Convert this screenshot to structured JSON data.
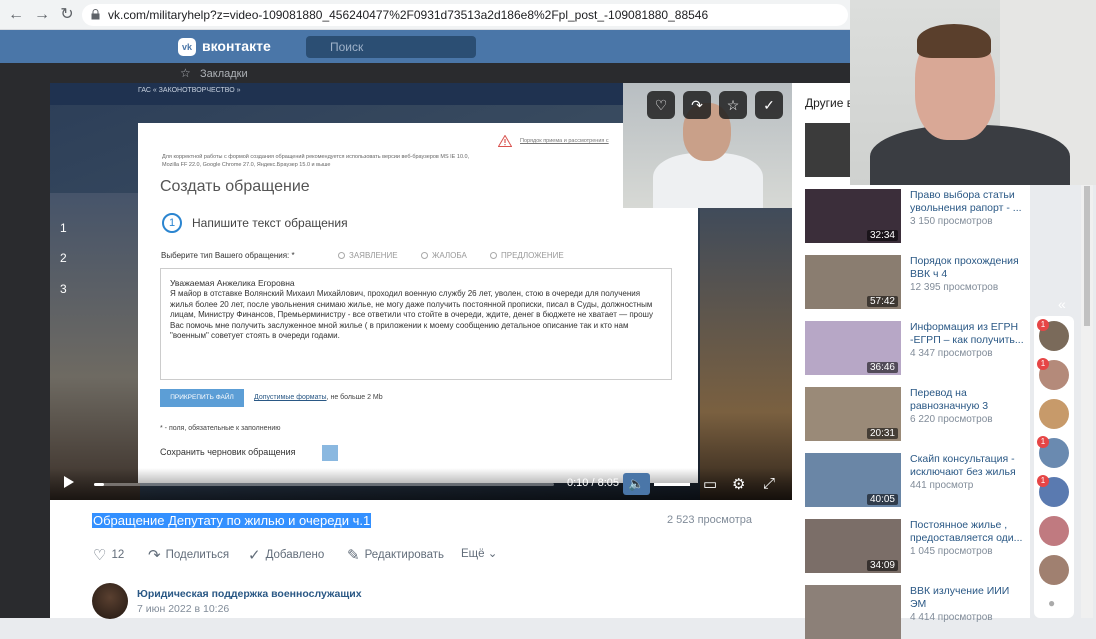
{
  "browser": {
    "url": "vk.com/militaryhelp?z=video-109081880_456240477%2F0931d73513a2d186e8%2Fpl_post_-109081880_88546",
    "back_icon": "←",
    "forward_icon": "→",
    "reload_icon": "↻"
  },
  "vk_header": {
    "logo": "vk",
    "brand": "вконтакте",
    "search_placeholder": "Поиск",
    "bookmarks_label": "Закладки"
  },
  "video": {
    "gas_label": "ГАС « ЗАКОНОТВОРЧЕСТВО »",
    "form": {
      "browser_note": "Для корректной работы с формой создания обращений рекомендуется использовать версии веб-браузеров MS IE 10.0, Mozilla FF 22.0, Google Chrome 27.0, Яндекс.Браузер 15.0 и выше",
      "order_link": "Порядок приема и рассмотрения с",
      "title": "Создать обращение",
      "step_number": "1",
      "step_text": "Напишите текст обращения",
      "type_label": "Выберите тип Вашего обращения: *",
      "radio_1": "ЗАЯВЛЕНИЕ",
      "radio_2": "ЖАЛОБА",
      "radio_3": "ПРЕДЛОЖЕНИЕ",
      "greeting": "Уважаемая Анжелика Егоровна",
      "body": "Я майор в отставке Волянский Михаил Михайлович, проходил военную службу 26 лет, уволен, стою в очереди для получения жилья более 20 лет, после увольнения снимаю жилье, не могу даже получить постоянной прописки, писал в Суды, должностным лицам, Министру Финансов, Премьерминистру - все ответили что стойте в очереди, ждите, денег в бюджете не хватает — прошу Вас помочь мне получить заслуженное мной жилье ( в приложении к моему сообщению детальное описание так и кто нам \"военным\" советует стоять в очереди  годами.",
      "attach_button": "ПРИКРЕПИТЬ ФАЙЛ",
      "formats_link": "Допустимые форматы",
      "formats_rest": ", не больше 2 Mb",
      "required_note": "* - поля, обязательные к заполнению",
      "draft_label": "Сохранить черновик обращения"
    },
    "side_numbers": [
      "1",
      "2",
      "3"
    ],
    "player": {
      "current_time": "0:10",
      "total_time": "8:05",
      "time_separator": " / ",
      "progress_fraction": 0.021
    },
    "overlay_buttons": {
      "like_icon": "♡",
      "share_icon": "↷",
      "save_icon": "☆",
      "done_icon": "✓"
    }
  },
  "video_info": {
    "title": "Обращение Депутату по жилью и очереди ч.1",
    "views": "2 523 просмотра",
    "likes": "12",
    "share_label": "Поделиться",
    "added_label": "Добавлено",
    "edit_label": "Редактировать",
    "more_label": "Ещё",
    "author": "Юридическая поддержка военнослужащих",
    "date": "7 июн 2022 в 10:26"
  },
  "sidebar": {
    "title": "Другие в",
    "videos": [
      {
        "title": "Право выбора статьи увольнения рапорт - ...",
        "views": "3 150 просмотров",
        "duration": "32:34",
        "color": "#3b2e3a"
      },
      {
        "title": "Порядок прохождения ВВК ч 4",
        "views": "12 395 просмотров",
        "duration": "57:42",
        "color": "#8a7d70"
      },
      {
        "title": "Информация из ЕГРН -ЕГРП – как получить...",
        "views": "4 347 просмотров",
        "duration": "36:46",
        "color": "#b7a7c6"
      },
      {
        "title": "Перевод на равнозначную 3",
        "views": "6 220 просмотров",
        "duration": "20:31",
        "color": "#9a8a78"
      },
      {
        "title": "Скайп консультация - исключают без жилья",
        "views": "441 просмотр",
        "duration": "40:05",
        "color": "#6a86a6"
      },
      {
        "title": "Постоянное жилье , предоставляется оди...",
        "views": "1 045 просмотров",
        "duration": "34:09",
        "color": "#7b6e68"
      },
      {
        "title": "ВВК излучение ИИИ ЭМ",
        "views": "4 414 просмотров",
        "duration": "",
        "color": "#8c8078"
      }
    ]
  },
  "chat": {
    "badges": [
      "1",
      "1",
      "1",
      "1",
      "1"
    ]
  }
}
